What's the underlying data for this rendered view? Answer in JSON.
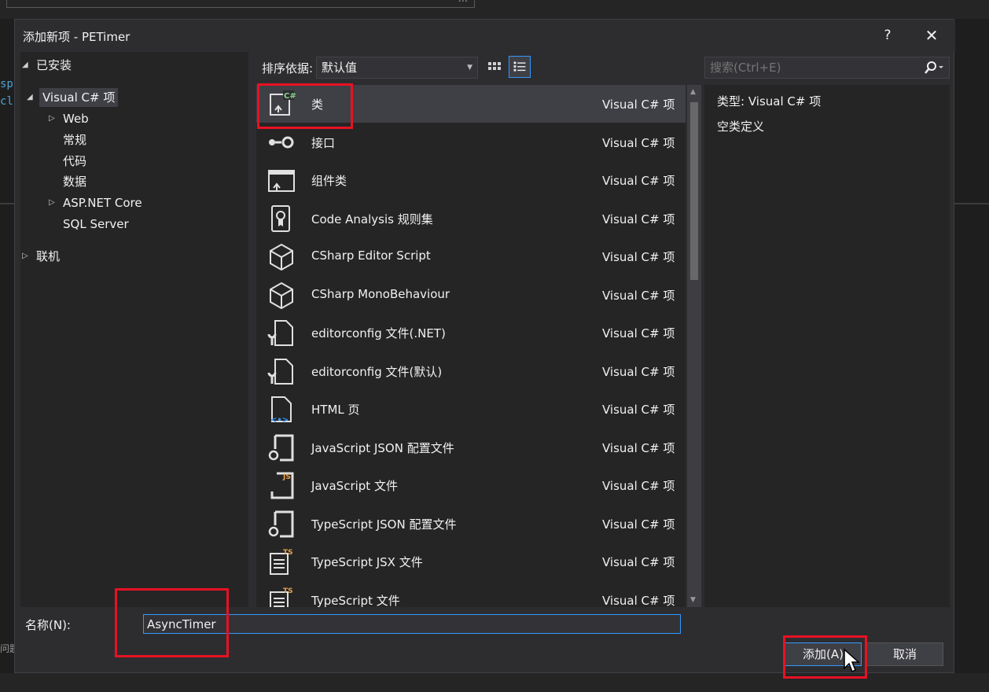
{
  "background": {
    "code_snippet": "sp\ncl",
    "top_box_suffix": "...",
    "bottom_left_text": "问题"
  },
  "dialog": {
    "title": "添加新项 - PETimer",
    "help_label": "?",
    "close_label": "✕"
  },
  "tree": {
    "installed": "已安装",
    "visual_csharp": "Visual C# 项",
    "web": "Web",
    "general": "常规",
    "code": "代码",
    "data": "数据",
    "aspnet_core": "ASP.NET Core",
    "sql_server": "SQL Server",
    "online": "联机"
  },
  "toolbar": {
    "sort_label": "排序依据:",
    "sort_value": "默认值",
    "search_placeholder": "搜索(Ctrl+E)"
  },
  "templates": [
    {
      "name": "类",
      "type": "Visual C# 项",
      "icon": "class-icon",
      "selected": true
    },
    {
      "name": "接口",
      "type": "Visual C# 项",
      "icon": "interface-icon"
    },
    {
      "name": "组件类",
      "type": "Visual C# 项",
      "icon": "component-class-icon"
    },
    {
      "name": "Code Analysis 规则集",
      "type": "Visual C# 项",
      "icon": "ruleset-icon"
    },
    {
      "name": "CSharp Editor Script",
      "type": "Visual C# 项",
      "icon": "cube-icon"
    },
    {
      "name": "CSharp MonoBehaviour",
      "type": "Visual C# 项",
      "icon": "cube-icon"
    },
    {
      "name": "editorconfig 文件(.NET)",
      "type": "Visual C# 项",
      "icon": "config-file-icon"
    },
    {
      "name": "editorconfig 文件(默认)",
      "type": "Visual C# 项",
      "icon": "config-file-icon"
    },
    {
      "name": "HTML 页",
      "type": "Visual C# 项",
      "icon": "html-file-icon"
    },
    {
      "name": "JavaScript JSON 配置文件",
      "type": "Visual C# 项",
      "icon": "json-config-icon"
    },
    {
      "name": "JavaScript 文件",
      "type": "Visual C# 项",
      "icon": "javascript-file-icon"
    },
    {
      "name": "TypeScript JSON 配置文件",
      "type": "Visual C# 项",
      "icon": "json-config-icon"
    },
    {
      "name": "TypeScript JSX 文件",
      "type": "Visual C# 项",
      "icon": "typescript-file-icon"
    },
    {
      "name": "TypeScript 文件",
      "type": "Visual C# 项",
      "icon": "typescript-file-icon"
    }
  ],
  "details": {
    "type_label": "类型:",
    "type_value": "Visual C# 项",
    "description": "空类定义"
  },
  "name_field": {
    "label": "名称(N):",
    "value": "AsyncTimer"
  },
  "buttons": {
    "add": "添加(A)",
    "cancel": "取消"
  },
  "colors": {
    "accent": "#3399ff",
    "annotation_red": "#e81123"
  }
}
